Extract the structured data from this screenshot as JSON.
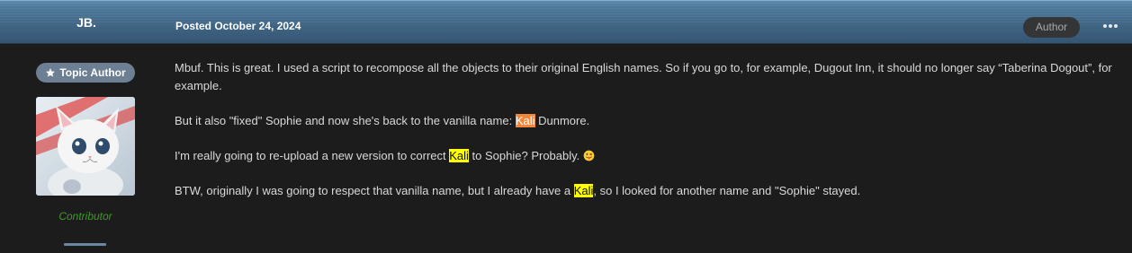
{
  "header": {
    "author_name": "JB.",
    "posted": "Posted October 24, 2024",
    "author_badge": "Author",
    "more_icon": "ellipsis-icon"
  },
  "author_panel": {
    "topic_author_label": "Topic Author",
    "topic_author_icon": "star-icon",
    "avatar": "kitten-astronaut-avatar",
    "group_title": "Contributor"
  },
  "post": {
    "p1": "Mbuf. This is great. I used a script to recompose all the objects to their original English names. So if you go to, for example, Dugout Inn, it should no longer say “Taberina Dogout”, for example.",
    "p2_before": "But it also \"fixed\" Sophie and now she's back to the vanilla name: ",
    "p2_highlight": "Kali",
    "p2_after": " Dunmore.",
    "p3_before": "I'm really going to re-upload a new version to correct ",
    "p3_highlight": "Kali",
    "p3_after": " to Sophie? Probably. ",
    "p3_emoji": "tongue-out-emoji-icon",
    "p4_before": "BTW, originally I was going to respect that vanilla name, but I already have a ",
    "p4_highlight": "Kali",
    "p4_after": ", so I looked for another name and \"Sophie\" stayed."
  },
  "colors": {
    "highlight_orange": "#f2873a",
    "highlight_yellow": "#ffff00",
    "group_green": "#3e9a2b",
    "header_blue": "#4f7a9b"
  }
}
